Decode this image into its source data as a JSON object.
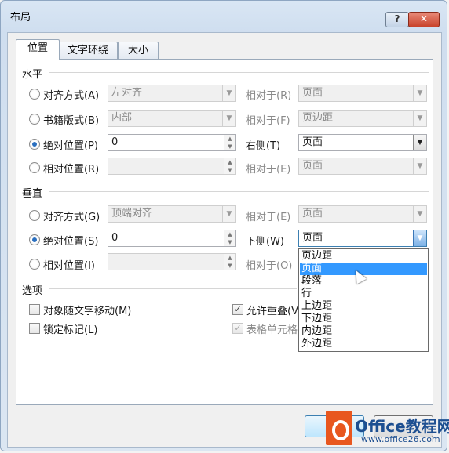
{
  "window": {
    "title": "布局",
    "help_label": "?",
    "close_label": "✕"
  },
  "tabs": [
    {
      "label": "位置"
    },
    {
      "label": "文字环绕"
    },
    {
      "label": "大小"
    }
  ],
  "horizontal": {
    "section_label": "水平",
    "rows": [
      {
        "radio_label": "对齐方式(A)",
        "value": "左对齐",
        "relative_label": "相对于(R)",
        "relative_value": "页面"
      },
      {
        "radio_label": "书籍版式(B)",
        "value": "内部",
        "relative_label": "相对于(F)",
        "relative_value": "页边距"
      },
      {
        "radio_label": "绝对位置(P)",
        "value": "0",
        "relative_label": "右侧(T)",
        "relative_value": "页面"
      },
      {
        "radio_label": "相对位置(R)",
        "value": "",
        "relative_label": "相对于(E)",
        "relative_value": "页面"
      }
    ]
  },
  "vertical": {
    "section_label": "垂直",
    "rows": [
      {
        "radio_label": "对齐方式(G)",
        "value": "顶端对齐",
        "relative_label": "相对于(E)",
        "relative_value": "页面"
      },
      {
        "radio_label": "绝对位置(S)",
        "value": "0",
        "relative_label": "下侧(W)",
        "relative_value": "页面"
      },
      {
        "radio_label": "相对位置(I)",
        "value": "",
        "relative_label": "相对于(O)",
        "relative_value": ""
      }
    ]
  },
  "options": {
    "section_label": "选项",
    "move_with_text": "对象随文字移动(M)",
    "lock_anchor": "锁定标记(L)",
    "allow_overlap": "允许重叠(V",
    "in_table_cell": "表格单元格"
  },
  "dropdown": {
    "items": [
      "页边距",
      "页面",
      "段落",
      "行",
      "上边距",
      "下边距",
      "内边距",
      "外边距"
    ],
    "highlighted": "页面"
  },
  "watermark": {
    "line1": "Office教程网",
    "line2": "www.office26.com"
  }
}
